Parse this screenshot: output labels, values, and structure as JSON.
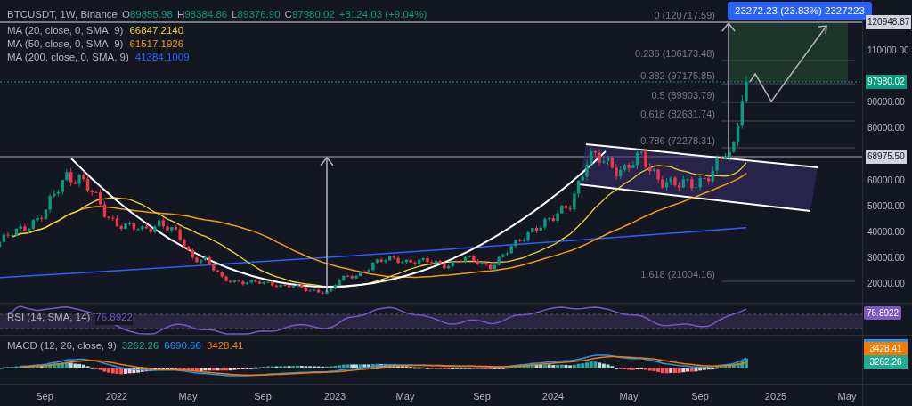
{
  "legend": {
    "symbol": "BTCUSDT, 1W, Binance",
    "ohlc": [
      {
        "label": "O",
        "value": "89855.98"
      },
      {
        "label": "H",
        "value": "98384.86"
      },
      {
        "label": "L",
        "value": "89376.90"
      },
      {
        "label": "C",
        "value": "97980.02"
      }
    ],
    "change": "+8124.03 (+9.04%)"
  },
  "moving_averages": [
    {
      "label": "MA (20, close, 0, SMA, 9)",
      "value": "66847.2140",
      "color": "#f2d330"
    },
    {
      "label": "MA (50, close, 0, SMA, 9)",
      "value": "61517.1926",
      "color": "#f59b0e"
    },
    {
      "label": "MA (200, close, 0, SMA, 9)",
      "value": "41384.1009",
      "color": "#2962ff"
    }
  ],
  "measure_badge": "23272.23 (23.83%) 2327223",
  "fib_levels": [
    "0 (120717.59)",
    "0.236 (106173.48)",
    "0.382 (97175.85)",
    "0.5 (89903.79)",
    "0.618 (82631.74)",
    "0.786 (72278.31)",
    "1.618 (21004.16)"
  ],
  "price_axis": [
    {
      "label": "120948.87",
      "kind": "marker"
    },
    {
      "label": "110000.00",
      "kind": "tick"
    },
    {
      "label": "97980.02",
      "kind": "last"
    },
    {
      "label": "90000.00",
      "kind": "tick"
    },
    {
      "label": "80000.00",
      "kind": "tick"
    },
    {
      "label": "68975.50",
      "kind": "marker"
    },
    {
      "label": "60000.00",
      "kind": "tick"
    },
    {
      "label": "50000.00",
      "kind": "tick"
    },
    {
      "label": "40000.00",
      "kind": "tick"
    },
    {
      "label": "30000.00",
      "kind": "tick"
    },
    {
      "label": "20000.00",
      "kind": "tick"
    }
  ],
  "rsi": {
    "legend": "RSI (14, SMA, 14)",
    "value": "76.8922",
    "badge": "76.8922"
  },
  "macd": {
    "legend": "MACD (12, 26, close, 9)",
    "values": [
      {
        "value": "3262.26",
        "color": "#22ab94"
      },
      {
        "value": "6690.66",
        "color": "#2196f3"
      },
      {
        "value": "3428.41",
        "color": "#f57c00"
      }
    ],
    "badges": [
      {
        "label": "3428.41",
        "color": "#f57c00"
      },
      {
        "label": "3262.26",
        "color": "#22ab94"
      }
    ]
  },
  "time_axis": [
    "Sep",
    "2022",
    "May",
    "Sep",
    "2023",
    "May",
    "Sep",
    "2024",
    "May",
    "Sep",
    "2025",
    "May"
  ]
}
